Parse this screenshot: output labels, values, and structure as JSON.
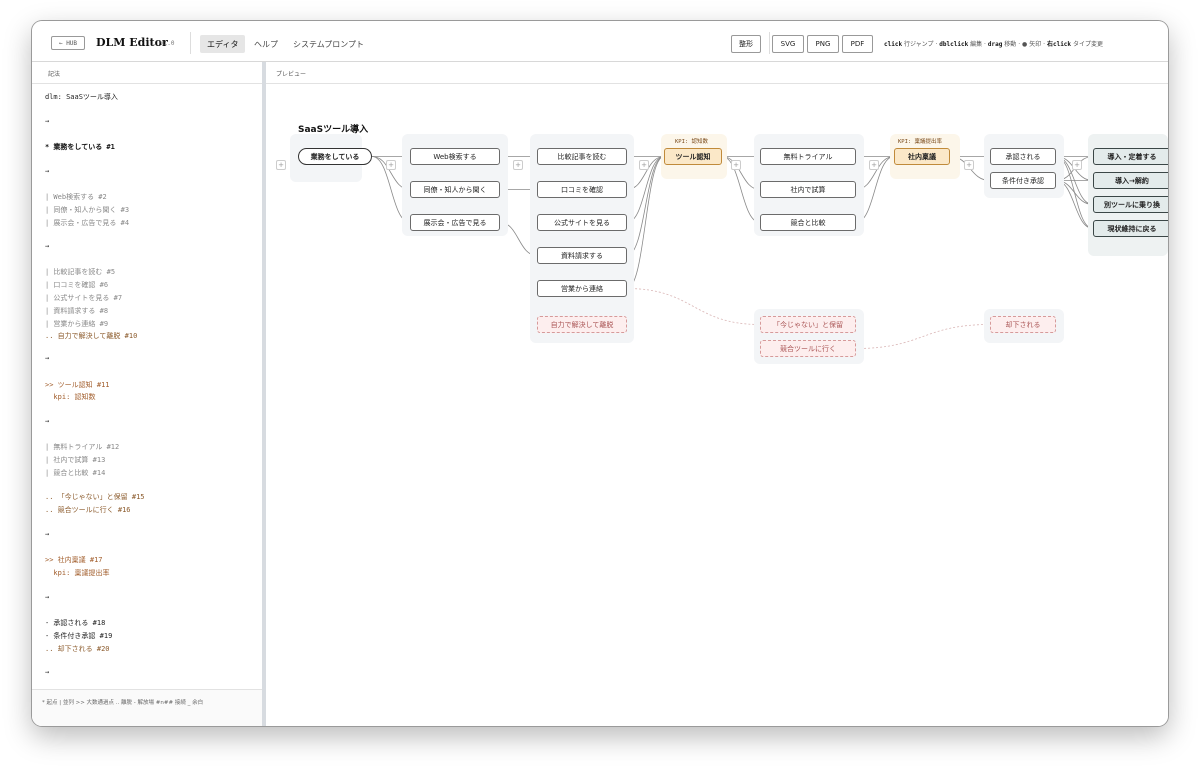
{
  "header": {
    "hub_button": "← HUB",
    "app_title": "DLM Editor",
    "version": "V1.0",
    "tabs": [
      "エディタ",
      "ヘルプ",
      "システムプロンプト"
    ],
    "format_button": "整形",
    "export_buttons": [
      "SVG",
      "PNG",
      "PDF"
    ],
    "hints": {
      "k1": "click",
      "v1": "行ジャンプ",
      "k2": "dblclick",
      "v2": "編集",
      "k3": "drag",
      "v3": "移動",
      "v4": "● 矢印",
      "k5": "右click",
      "v5": "タイプ変更",
      "sep": "·"
    }
  },
  "editor": {
    "header": "記法",
    "lines": [
      {
        "text": "dlm: SaaSツール導入",
        "cls": "c-dark"
      },
      {
        "text": "→",
        "cls": "c-arrow"
      },
      {
        "text": "* 業務をしている #1",
        "cls": "c-bold"
      },
      {
        "text": "→",
        "cls": "c-arrow"
      },
      {
        "text": "| Web検索する #2",
        "cls": "c-dim"
      },
      {
        "text": "| 同僚・知人から聞く #3",
        "cls": "c-dim"
      },
      {
        "text": "| 展示会・広告で見る #4",
        "cls": "c-dim"
      },
      {
        "text": "→",
        "cls": "c-arrow"
      },
      {
        "text": "| 比較記事を読む #5",
        "cls": "c-dim"
      },
      {
        "text": "| 口コミを確認 #6",
        "cls": "c-dim"
      },
      {
        "text": "| 公式サイトを見る #7",
        "cls": "c-dim"
      },
      {
        "text": "| 資料請求する #8",
        "cls": "c-dim"
      },
      {
        "text": "| 営業から連絡 #9",
        "cls": "c-dim"
      },
      {
        "text": ".. 自力で解決して離脱 #10",
        "cls": "c-exit"
      },
      {
        "text": "→",
        "cls": "c-arrow"
      },
      {
        "text": ">> ツール認知 #11",
        "cls": "c-kpi"
      },
      {
        "text": "  kpi: 認知数",
        "cls": "c-kpi"
      },
      {
        "text": "→",
        "cls": "c-arrow"
      },
      {
        "text": "| 無料トライアル #12",
        "cls": "c-dim"
      },
      {
        "text": "| 社内で試算 #13",
        "cls": "c-dim"
      },
      {
        "text": "| 競合と比較 #14",
        "cls": "c-dim"
      },
      {
        "text": ".. 「今じゃない」と保留 #15",
        "cls": "c-exit"
      },
      {
        "text": ".. 競合ツールに行く #16",
        "cls": "c-exit"
      },
      {
        "text": "→",
        "cls": "c-arrow"
      },
      {
        "text": ">> 社内稟議 #17",
        "cls": "c-kpi"
      },
      {
        "text": "  kpi: 稟議提出率",
        "cls": "c-kpi"
      },
      {
        "text": "→",
        "cls": "c-arrow"
      },
      {
        "text": "- 承認される #18",
        "cls": "c-dark"
      },
      {
        "text": "- 条件付き承認 #19",
        "cls": "c-dark"
      },
      {
        "text": ".. 却下される #20",
        "cls": "c-exit"
      },
      {
        "text": "→",
        "cls": "c-arrow"
      }
    ],
    "legend": "* 起点 | 並列 >> 大数通過点 .. 離脱 - 解放場 #n## 接続 _ 余白"
  },
  "preview": {
    "header": "プレビュー",
    "title": "SaaSツール導入",
    "kpi_labels": [
      "KPI: 認知数",
      "KPI: 稟議提出率"
    ],
    "nodes": {
      "n1": "業務をしている",
      "n2": "Web検索する",
      "n3": "同僚・知人から聞く",
      "n4": "展示会・広告で見る",
      "n5": "比較記事を読む",
      "n6": "口コミを確認",
      "n7": "公式サイトを見る",
      "n8": "資料請求する",
      "n9": "営業から連絡",
      "n10": "自力で解決して離脱",
      "n11": "ツール認知",
      "n12": "無料トライアル",
      "n13": "社内で試算",
      "n14": "競合と比較",
      "n15": "「今じゃない」と保留",
      "n16": "競合ツールに行く",
      "n17": "社内稟議",
      "n18": "承認される",
      "n19": "条件付き承認",
      "n20": "却下される",
      "n21": "導入・定着する",
      "n22": "導入→解約",
      "n23": "別ツールに乗り換",
      "n24": "現状維持に戻る"
    }
  }
}
